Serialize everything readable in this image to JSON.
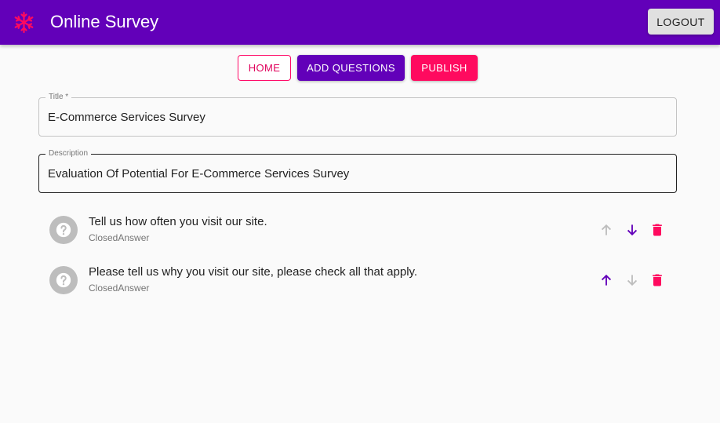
{
  "header": {
    "app_title": "Online Survey",
    "logout_label": "LOGOUT",
    "logo_icon": "snowflake-icon",
    "colors": {
      "appbar": "#6200b9",
      "logo": "#ff0a5f"
    }
  },
  "nav": {
    "home_label": "HOME",
    "add_questions_label": "ADD QUESTIONS",
    "publish_label": "PUBLISH"
  },
  "form": {
    "title": {
      "label": "Title *",
      "value": "E-Commerce Services Survey"
    },
    "description": {
      "label": "Description",
      "value": "Evaluation Of Potential For E-Commerce Services Survey"
    }
  },
  "questions": [
    {
      "text": "Tell us how often you visit our site.",
      "type": "ClosedAnswer",
      "icon": "help-circle-icon",
      "move_up_enabled": false,
      "move_down_enabled": true
    },
    {
      "text": "Please tell us why you visit our site, please check all that apply.",
      "type": "ClosedAnswer",
      "icon": "help-circle-icon",
      "move_up_enabled": true,
      "move_down_enabled": false
    }
  ],
  "colors": {
    "primary": "#6200b9",
    "secondary": "#ff0a5f",
    "disabled": "#bdbdbd"
  }
}
